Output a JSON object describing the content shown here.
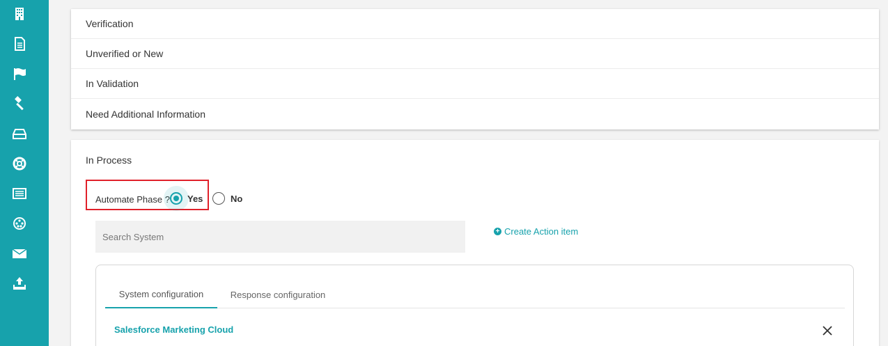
{
  "colors": {
    "accent": "#17a2ac",
    "highlight_border": "#e0202a"
  },
  "sidebar": {
    "items": [
      {
        "icon": "building-icon"
      },
      {
        "icon": "document-icon"
      },
      {
        "icon": "flag-icon"
      },
      {
        "icon": "gavel-icon"
      },
      {
        "icon": "hard-drive-icon"
      },
      {
        "icon": "lifebuoy-icon"
      },
      {
        "icon": "list-card-icon"
      },
      {
        "icon": "circle-dots-icon"
      },
      {
        "icon": "envelope-icon"
      },
      {
        "icon": "upload-icon"
      }
    ]
  },
  "phases": {
    "rows": [
      "Verification",
      "Unverified or New",
      "In Validation",
      "Need Additional Information"
    ]
  },
  "in_process": {
    "title": "In Process",
    "automate_label": "Automate Phase ?",
    "yes_label": "Yes",
    "no_label": "No",
    "selected": "Yes",
    "search_placeholder": "Search System",
    "create_action_label": "Create Action item",
    "tabs": [
      "System configuration",
      "Response configuration"
    ],
    "active_tab": "System configuration",
    "system_name": "Salesforce Marketing Cloud"
  }
}
